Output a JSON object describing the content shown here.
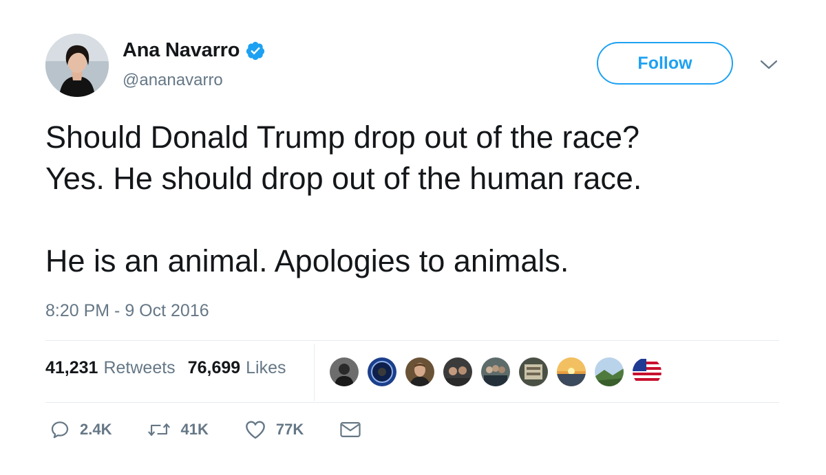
{
  "user": {
    "name": "Ana Navarro",
    "handle": "@ananavarro",
    "verified_icon": "verified-badge-icon",
    "avatar_icon": "profile-photo"
  },
  "header": {
    "follow_label": "Follow",
    "caret_icon": "chevron-down-icon"
  },
  "tweet": {
    "lines": [
      "Should Donald Trump drop out of the race?",
      "Yes. He should drop out of the human race.",
      "He is an animal. Apologies to animals."
    ],
    "timestamp": "8:20 PM - 9 Oct 2016"
  },
  "stats": {
    "retweets_count": "41,231",
    "retweets_label": "Retweets",
    "likes_count": "76,699",
    "likes_label": "Likes"
  },
  "likers": [
    "liker-avatar",
    "liker-avatar",
    "liker-avatar",
    "liker-avatar",
    "liker-avatar",
    "liker-avatar",
    "liker-avatar",
    "liker-avatar",
    "liker-avatar"
  ],
  "actions": {
    "reply_count": "2.4K",
    "retweet_count": "41K",
    "like_count": "77K",
    "reply_icon": "reply-icon",
    "retweet_icon": "retweet-icon",
    "like_icon": "heart-icon",
    "dm_icon": "envelope-icon"
  },
  "colors": {
    "accent": "#1da1f2",
    "text": "#14171a",
    "secondary": "#657786",
    "divider": "#e6ecf0"
  }
}
